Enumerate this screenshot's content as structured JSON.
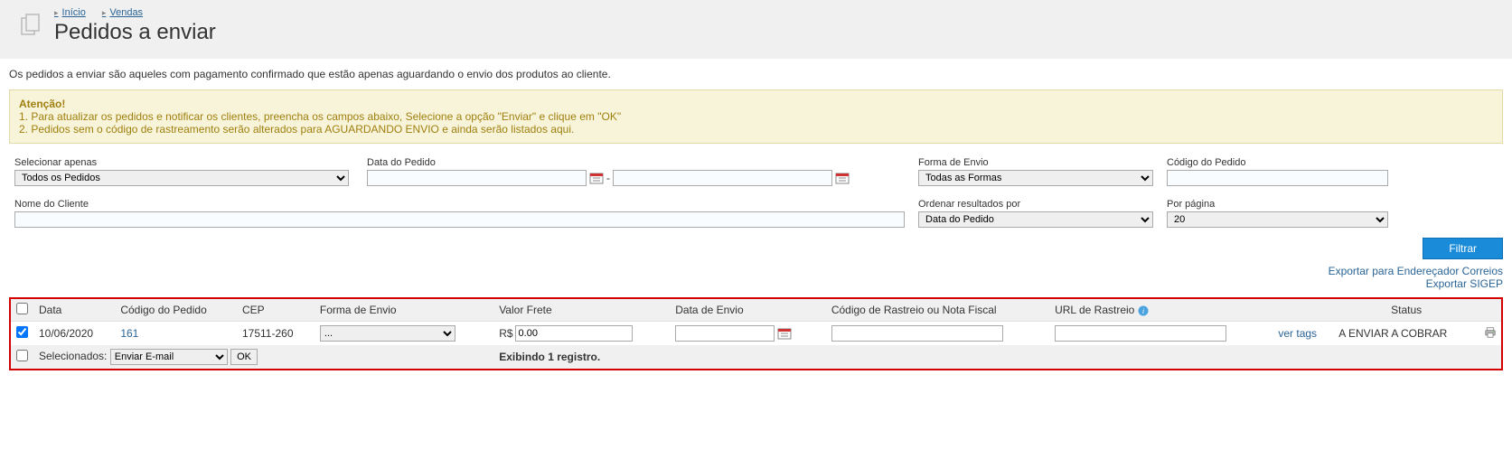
{
  "breadcrumbs": {
    "home": "Início",
    "sales": "Vendas"
  },
  "title": "Pedidos a enviar",
  "description": "Os pedidos a enviar são aqueles com pagamento confirmado que estão apenas aguardando o envio dos produtos ao cliente.",
  "alert": {
    "title": "Atenção!",
    "line1": "1. Para atualizar os pedidos e notificar os clientes, preencha os campos abaixo, Selecione a opção \"Enviar\" e clique em \"OK\"",
    "line2": "2. Pedidos sem o código de rastreamento serão alterados para AGUARDANDO ENVIO e ainda serão listados aqui."
  },
  "filters": {
    "select_only_label": "Selecionar apenas",
    "select_only_value": "Todos os Pedidos",
    "order_date_label": "Data do Pedido",
    "shipping_method_label": "Forma de Envio",
    "shipping_method_value": "Todas as Formas",
    "order_code_label": "Código do Pedido",
    "customer_name_label": "Nome do Cliente",
    "sort_label": "Ordenar resultados por",
    "sort_value": "Data do Pedido",
    "per_page_label": "Por página",
    "per_page_value": "20",
    "filter_button": "Filtrar"
  },
  "export": {
    "correios": "Exportar para Endereçador Correios",
    "sigep": "Exportar SIGEP"
  },
  "table": {
    "headers": {
      "date": "Data",
      "order_code": "Código do Pedido",
      "cep": "CEP",
      "shipping_method": "Forma de Envio",
      "freight_value": "Valor Frete",
      "ship_date": "Data de Envio",
      "tracking": "Código de Rastreio ou Nota Fiscal",
      "tracking_url": "URL de Rastreio",
      "status": "Status"
    },
    "rows": [
      {
        "date": "10/06/2020",
        "order_code": "161",
        "cep": "17511-260",
        "shipping_method": "...",
        "currency": "R$",
        "freight_value": "0.00",
        "ship_date": "",
        "tracking": "",
        "tracking_url": "",
        "ver_tags": "ver tags",
        "status": "A ENVIAR A COBRAR"
      }
    ],
    "footer": {
      "selected_label": "Selecionados:",
      "action_value": "Enviar E-mail",
      "ok": "OK",
      "summary": "Exibindo 1 registro."
    }
  }
}
